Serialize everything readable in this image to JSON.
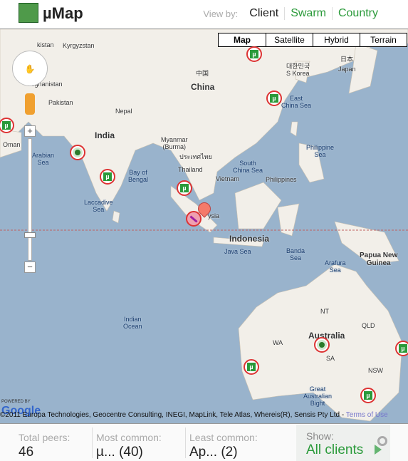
{
  "header": {
    "title": "µMap",
    "view_by_label": "View by:",
    "view_options": [
      "Client",
      "Swarm",
      "Country"
    ]
  },
  "map": {
    "types": [
      "Map",
      "Satellite",
      "Hybrid",
      "Terrain"
    ],
    "labels": {
      "kazakhstan": "kistan",
      "kyrgyzstan": "Kyrgyzstan",
      "afghanistan": "Afghanistan",
      "pakistan": "Pakistan",
      "nepal": "Nepal",
      "china_zh": "中国",
      "china": "China",
      "india": "India",
      "oman": "Oman",
      "arabian_sea": "Arabian\nSea",
      "bay_of_bengal": "Bay of\nBengal",
      "myanmar": "Myanmar\n(Burma)",
      "thailand_th": "ประเทศไทย",
      "thailand": "Thailand",
      "vietnam": "Vietnam",
      "laccadive": "Laccadive\nSea",
      "south_china_sea": "South\nChina Sea",
      "philippines": "Philippines",
      "philippine_sea": "Philippine\nSea",
      "east_china_sea": "East\nChina Sea",
      "korea_ko": "대한민국",
      "korea": "S Korea",
      "japan_ja": "日本",
      "japan": "Japan",
      "malaysia": "ysia",
      "indonesia": "Indonesia",
      "java_sea": "Java Sea",
      "banda_sea": "Banda\nSea",
      "arafura_sea": "Arafura\nSea",
      "png": "Papua New\nGuinea",
      "indian_ocean": "Indian\nOcean",
      "nt": "NT",
      "qld": "QLD",
      "wa": "WA",
      "australia": "Australia",
      "sa": "SA",
      "nsw": "NSW",
      "great_bight": "Great\nAustralian\nBight"
    },
    "powered_by": "POWERED BY",
    "google_logo": "Google",
    "attribution": "©2011 Europa Technologies, Geocentre Consulting, INEGI, MapLink, Tele Atlas, Whereis(R), Sensis Pty Ltd - ",
    "terms": "Terms of Use",
    "colors": {
      "ocean": "#99b3cc",
      "land": "#f2efe9",
      "marker_ring": "#dd3333",
      "utorrent": "#2a9a3a"
    }
  },
  "footer": {
    "total_label": "Total peers:",
    "total_value": "46",
    "most_label": "Most common:",
    "most_value": "µ... (40)",
    "least_label": "Least common:",
    "least_value": "Ap... (2)",
    "show_label": "Show:",
    "show_value": "All clients"
  }
}
